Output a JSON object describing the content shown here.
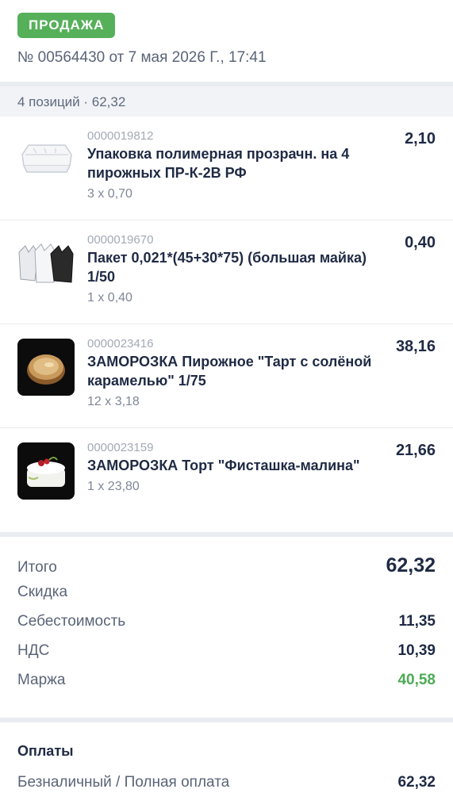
{
  "header": {
    "badge": "ПРОДАЖА",
    "title": "№ 00564430 от 7 мая 2026 Г., 17:41"
  },
  "summary": "4 позиций · 62,32",
  "items": [
    {
      "code": "0000019812",
      "name": "Упаковка полимерная прозрачн. на 4 пирожных ПР-К-2В РФ",
      "qty": "3 x 0,70",
      "price": "2,10",
      "image": "plastic-container-icon"
    },
    {
      "code": "0000019670",
      "name": "Пакет 0,021*(45+30*75) (большая майка) 1/50",
      "qty": "1 x 0,40",
      "price": "0,40",
      "image": "plastic-bags-icon"
    },
    {
      "code": "0000023416",
      "name": "ЗАМОРОЗКА Пирожное \"Тарт с солёной карамелью\" 1/75",
      "qty": "12 x 3,18",
      "price": "38,16",
      "image": "tart-icon"
    },
    {
      "code": "0000023159",
      "name": "ЗАМОРОЗКА Торт \"Фисташка-малина\"",
      "qty": "1 x 23,80",
      "price": "21,66",
      "image": "cake-icon"
    }
  ],
  "totals": {
    "total_label": "Итого",
    "total_value": "62,32",
    "discount_label": "Скидка",
    "cost_label": "Себестоимость",
    "cost_value": "11,35",
    "vat_label": "НДС",
    "vat_value": "10,39",
    "margin_label": "Маржа",
    "margin_value": "40,58"
  },
  "payments": {
    "title": "Оплаты",
    "method": "Безналичный / Полная оплата",
    "amount": "62,32"
  },
  "colors": {
    "badge": "#56b05a",
    "margin": "#4daa57",
    "text": "#1f2a44"
  }
}
